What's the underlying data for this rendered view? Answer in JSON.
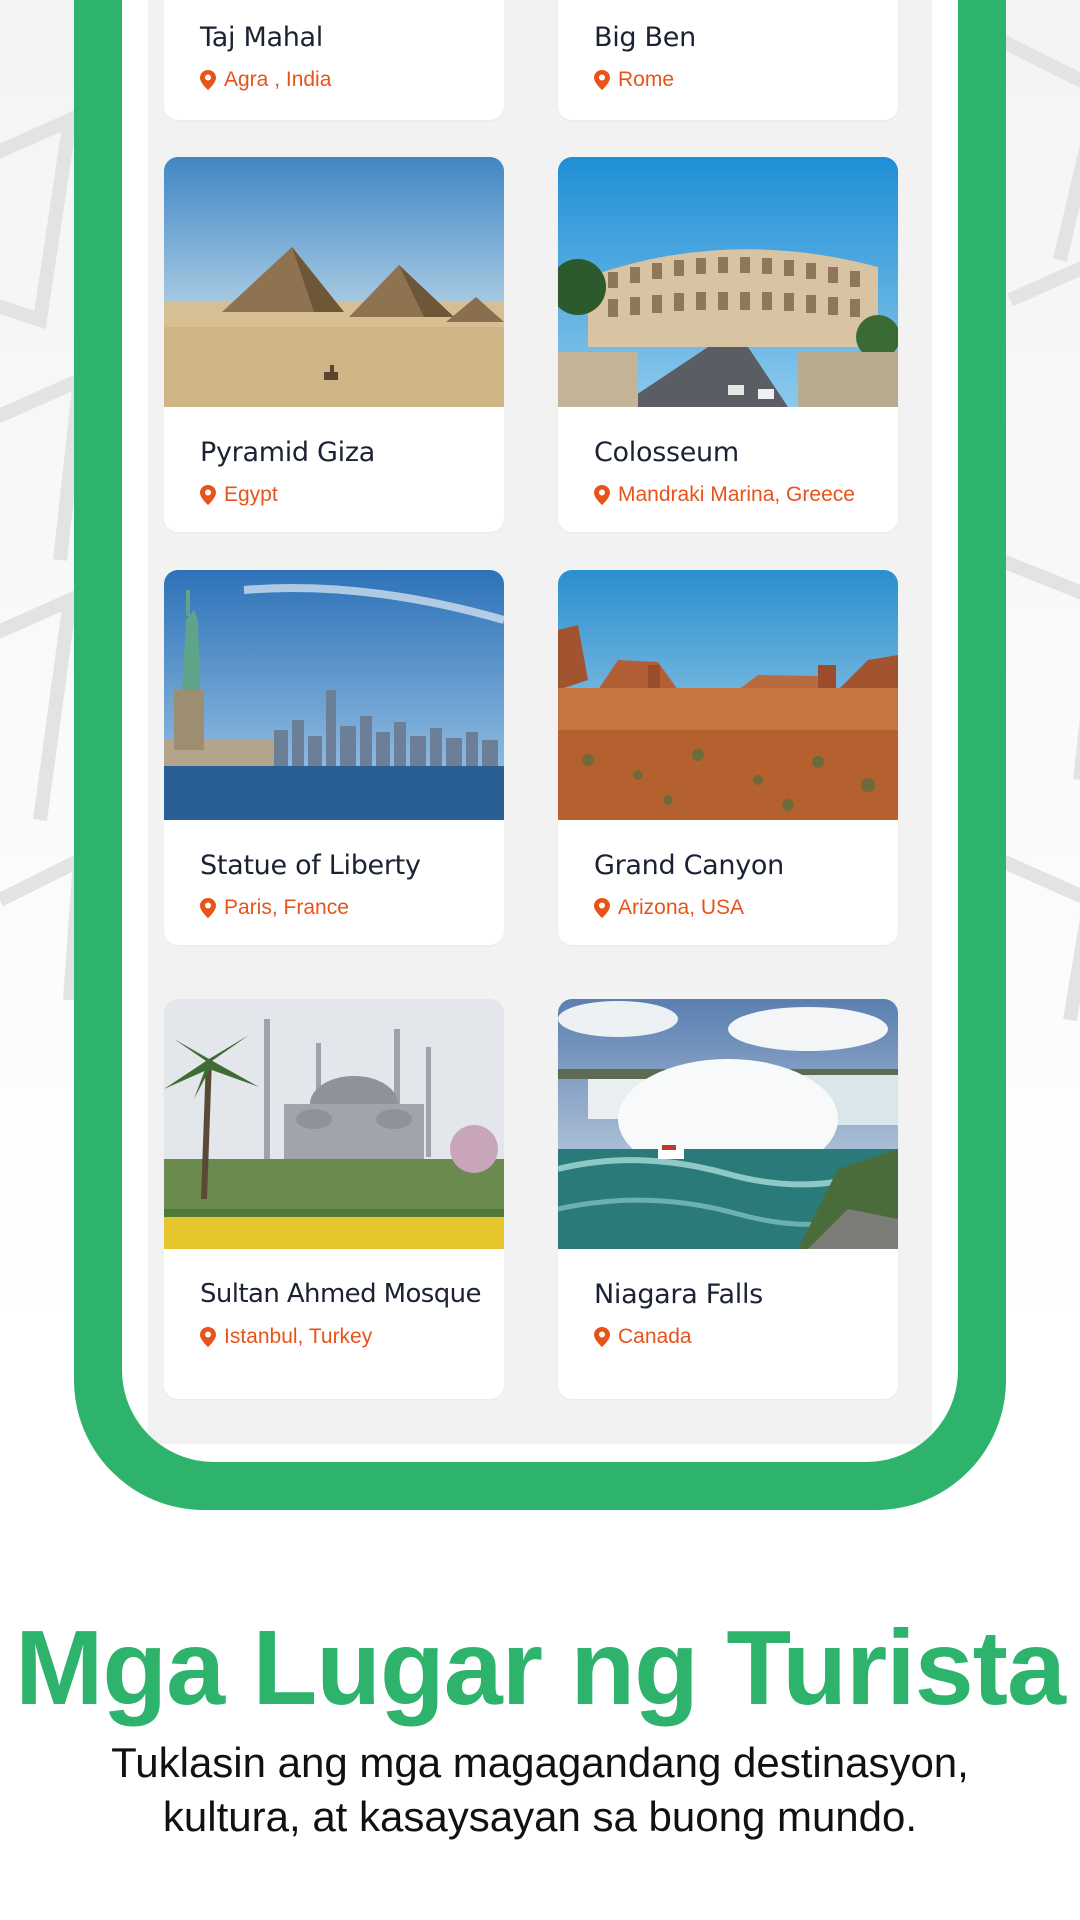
{
  "places": [
    {
      "name": "Taj Mahal",
      "location": "Agra , India"
    },
    {
      "name": "Big Ben",
      "location": "Rome"
    },
    {
      "name": "Pyramid Giza",
      "location": "Egypt"
    },
    {
      "name": "Colosseum",
      "location": "Mandraki Marina, Greece"
    },
    {
      "name": "Statue of Liberty",
      "location": "Paris, France"
    },
    {
      "name": "Grand Canyon",
      "location": "Arizona, USA"
    },
    {
      "name": "Sultan Ahmed Mosque",
      "location": "Istanbul, Turkey"
    },
    {
      "name": "Niagara Falls",
      "location": "Canada"
    }
  ],
  "promo": {
    "headline": "Mga Lugar ng Turista",
    "subtitle_line1": "Tuklasin ang mga magagandang destinasyon,",
    "subtitle_line2": "kultura, at kasaysayan sa buong mundo."
  },
  "colors": {
    "brand_green": "#2db36b",
    "location_orange": "#e8531a",
    "title_dark": "#1b2233"
  },
  "icons": {
    "location": "map-pin-icon"
  }
}
